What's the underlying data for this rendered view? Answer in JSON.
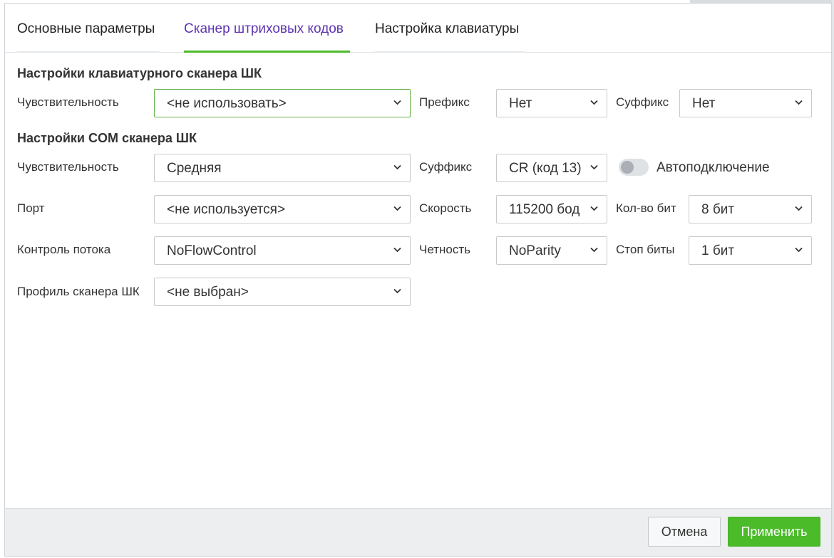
{
  "tabs": [
    {
      "label": "Основные параметры",
      "active": false
    },
    {
      "label": "Сканер штриховых кодов",
      "active": true
    },
    {
      "label": "Настройка клавиатуры",
      "active": false
    }
  ],
  "keyboard_scanner": {
    "title": "Настройки клавиатурного сканера ШК",
    "sensitivity": {
      "label": "Чувствительность",
      "value": "<не использовать>"
    },
    "prefix": {
      "label": "Префикс",
      "value": "Нет"
    },
    "suffix": {
      "label": "Суффикс",
      "value": "Нет"
    }
  },
  "com_scanner": {
    "title": "Настройки COM сканера ШК",
    "sensitivity": {
      "label": "Чувствительность",
      "value": "Средняя"
    },
    "suffix": {
      "label": "Суффикс",
      "value": "CR (код 13)"
    },
    "autoconnect": {
      "label": "Автоподключение",
      "enabled": false
    },
    "port": {
      "label": "Порт",
      "value": "<не используется>"
    },
    "speed": {
      "label": "Скорость",
      "value": "115200 бод"
    },
    "bits": {
      "label": "Кол-во бит",
      "value": "8 бит"
    },
    "flow_control": {
      "label": "Контроль потока",
      "value": "NoFlowControl"
    },
    "parity": {
      "label": "Четность",
      "value": "NoParity"
    },
    "stop_bits": {
      "label": "Стоп биты",
      "value": "1 бит"
    },
    "profile": {
      "label": "Профиль сканера ШК",
      "value": "<не выбран>"
    }
  },
  "footer": {
    "cancel_label": "Отмена",
    "apply_label": "Применить"
  },
  "colors": {
    "accent_green": "#4cbb2a",
    "active_tab_text": "#5e35b1",
    "focus_border": "#62b046"
  },
  "icons": {
    "dropdown": "chevron-down-icon"
  }
}
